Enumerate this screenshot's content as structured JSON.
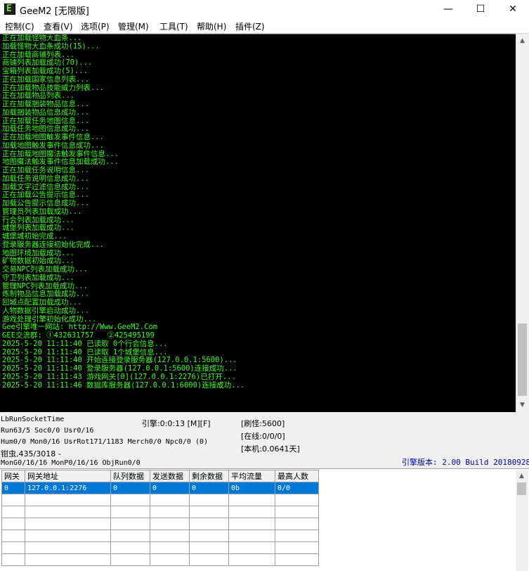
{
  "window": {
    "title": "GeeM2 [无限版]",
    "icon_letter": "E",
    "controls": {
      "minimize": "—",
      "maximize": "☐",
      "close": "✕"
    }
  },
  "menu": {
    "items": [
      "控制(C)",
      "查看(V)",
      "选项(P)",
      "管理(M)",
      "工具(T)",
      "帮助(H)",
      "插件(Z)"
    ]
  },
  "console": {
    "lines": [
      "正在加载怪物大血条...",
      "加载怪物大血条成功(15)...",
      "正在加载商铺列表...",
      "商铺列表加载成功(70)...",
      "宝箱列表加载成功(5)...",
      "正在加载国家信息列表...",
      "正在加载物品技能威力列表...",
      "正在加载物品列表...",
      "正在加载捆装物品信息...",
      "加载捆装物品信息成功...",
      "正在加载任务地图信息...",
      "加载任务地图信息成功...",
      "正在加载地图触发事件信息...",
      "加载地图触发事件信息成功...",
      "正在加载地图魔法触发事件信息...",
      "地图魔法触发事件信息加载成功...",
      "正在加载任务说明信息...",
      "加载任务说明信息成功...",
      "加载文字过滤信息成功...",
      "正在加载公告提示信息...",
      "加载公告提示信息成功...",
      "管理员列表加载成功...",
      "行会列表加载成功...",
      "城堡列表加载成功...",
      "城堡城初始完成...",
      "登录服务器连接初始化完成...",
      "地图环境加载成功...",
      "矿物数据初始成功...",
      "交易NPC列表加载成功...",
      "守卫列表加载成功...",
      "管理NPC列表加载成功...",
      "炼制物品信息加载成功...",
      "回城点配置加载成功...",
      "人物数据引擎启动成功...",
      "游戏处理引擎初始化成功...",
      "Gee引擎唯一网站: http://Www.GeeM2.Com",
      "GEE交流群: ①432631757   ②425495199",
      "2025-5-20 11:11:40 已读取 0个行会信息...",
      "2025-5-20 11:11:40 已读取 1个城堡信息...",
      "2025-5-20 11:11:40 开始连接登录服务器(127.0.0.1:5600)...",
      "2025-5-20 11:11:40 登录服务器(127.0.0.1:5600)连接成功...",
      "2025-5-20 11:11:43 游戏网关[0](127.0.0.1:2276)已打开...",
      "2025-5-20 11:11:46 数据库服务器(127.0.0.1:6000)连接成功..."
    ]
  },
  "status": {
    "line1": "LbRunSocketTime",
    "line2": "Run63/5 Soc0/0 Usr0/16",
    "line3": "Hum0/0 Mon0/16 UsrRot171/1183 Merch0/0 Npc0/0 (0)",
    "line4": "钳虫,435/3018 -",
    "line5": "MonG0/16/16 MonP0/16/16 ObjRun0/0",
    "engine_time": "引擎:0:0:13 [M][F]",
    "refresh_monsters": "[刷怪:5600]",
    "online": "[在线:0/0/0]",
    "local": "[本机:0.0641天]",
    "version": "引擎版本: 2.00 Build 20180928"
  },
  "gateway_table": {
    "columns": [
      "网关",
      "网关地址",
      "队列数据",
      "发送数据",
      "剩余数据",
      "平均流量",
      "最高人数"
    ],
    "rows": [
      [
        "0",
        "127.0.0.1:2276",
        "0",
        "0",
        "0",
        "0b",
        "0/0"
      ]
    ]
  },
  "colors": {
    "console_bg": "#000000",
    "console_text": "#39ff14",
    "version_text": "#0000c0",
    "selection": "#0078d7"
  }
}
